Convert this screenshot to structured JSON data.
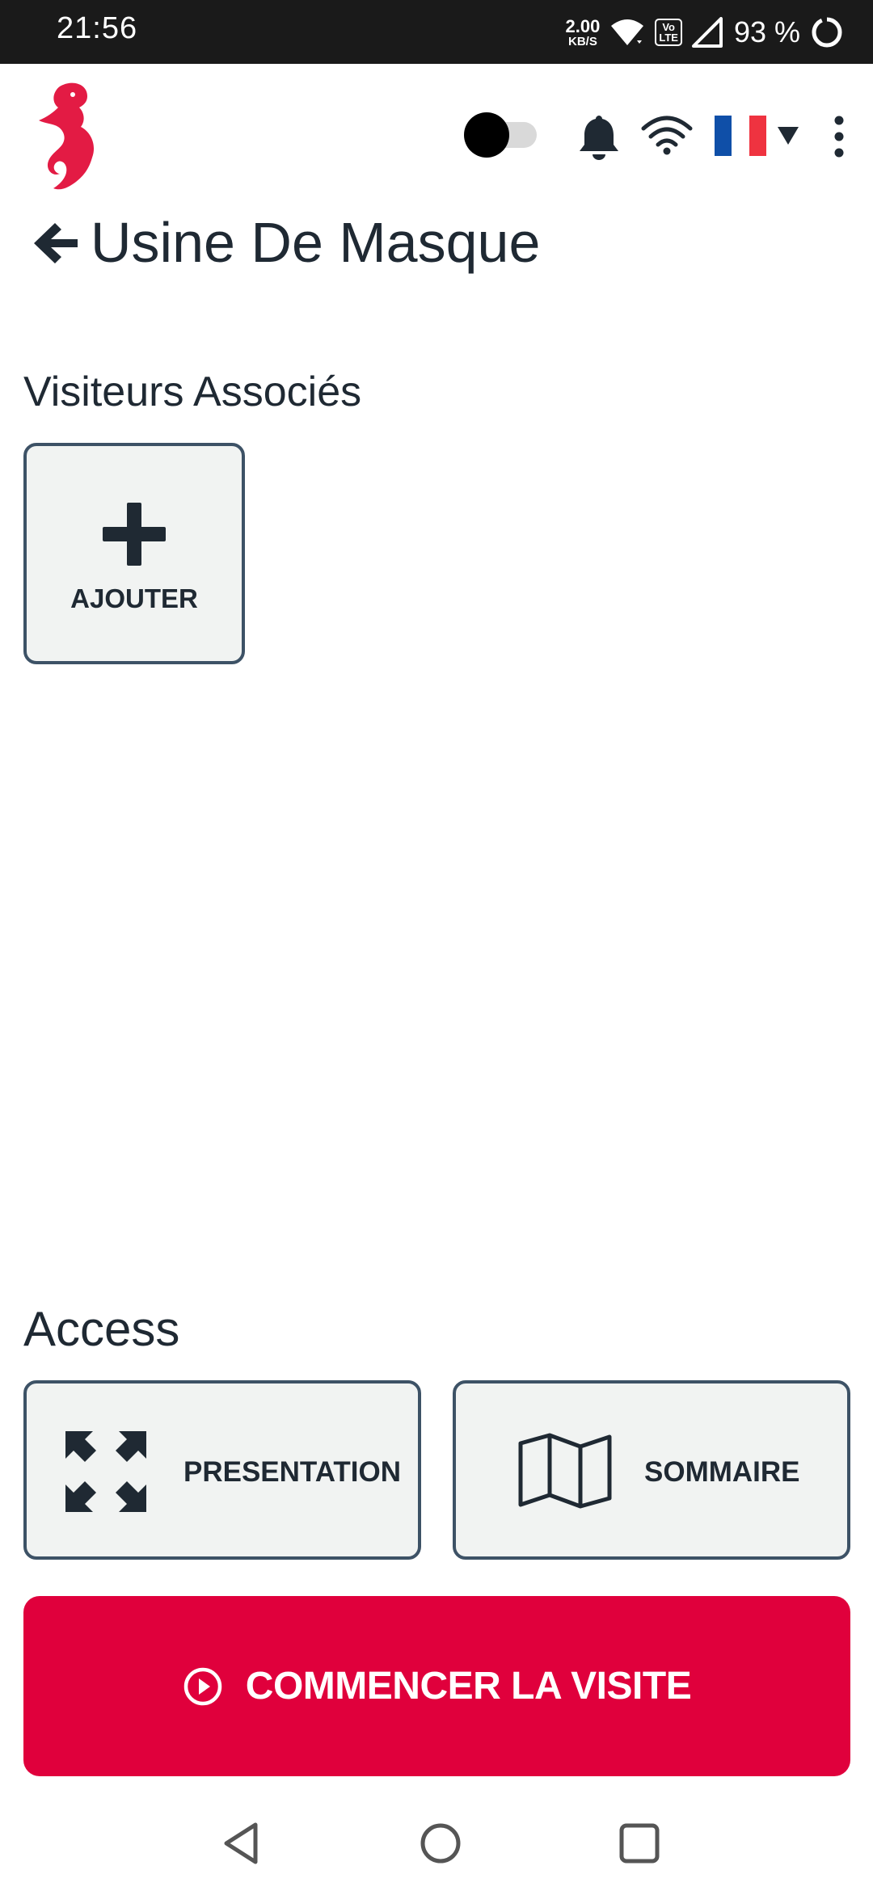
{
  "status_bar": {
    "time": "21:56",
    "net_speed_value": "2.00",
    "net_speed_unit": "KB/S",
    "volte_top": "Vo",
    "volte_bottom": "LTE",
    "battery": "93 %"
  },
  "header": {
    "language": "fr",
    "colors": {
      "brand": "#e31b44",
      "flag_blue": "#0f4fa8",
      "flag_white": "#ffffff",
      "flag_red": "#ef3340"
    }
  },
  "page": {
    "title": "Usine De Masque"
  },
  "visitors": {
    "section_title": "Visiteurs Associés",
    "add_label": "AJOUTER"
  },
  "access": {
    "section_title": "Access",
    "presentation_label": "PRESENTATION",
    "summary_label": "SOMMAIRE"
  },
  "cta": {
    "start_label": "COMMENCER LA VISITE",
    "color": "#e0003c"
  },
  "icons": {
    "status": [
      "wifi-icon",
      "volte-icon",
      "signal-icon",
      "battery-icon"
    ],
    "header": [
      "seahorse-logo",
      "bell-icon",
      "wifi-icon",
      "france-flag-icon",
      "chevron-down-icon",
      "more-vertical-icon"
    ],
    "buttons": [
      "plus-icon",
      "expand-icon",
      "map-icon",
      "play-circle-icon"
    ],
    "nav": [
      "nav-back-icon",
      "nav-home-icon",
      "nav-recents-icon"
    ]
  }
}
